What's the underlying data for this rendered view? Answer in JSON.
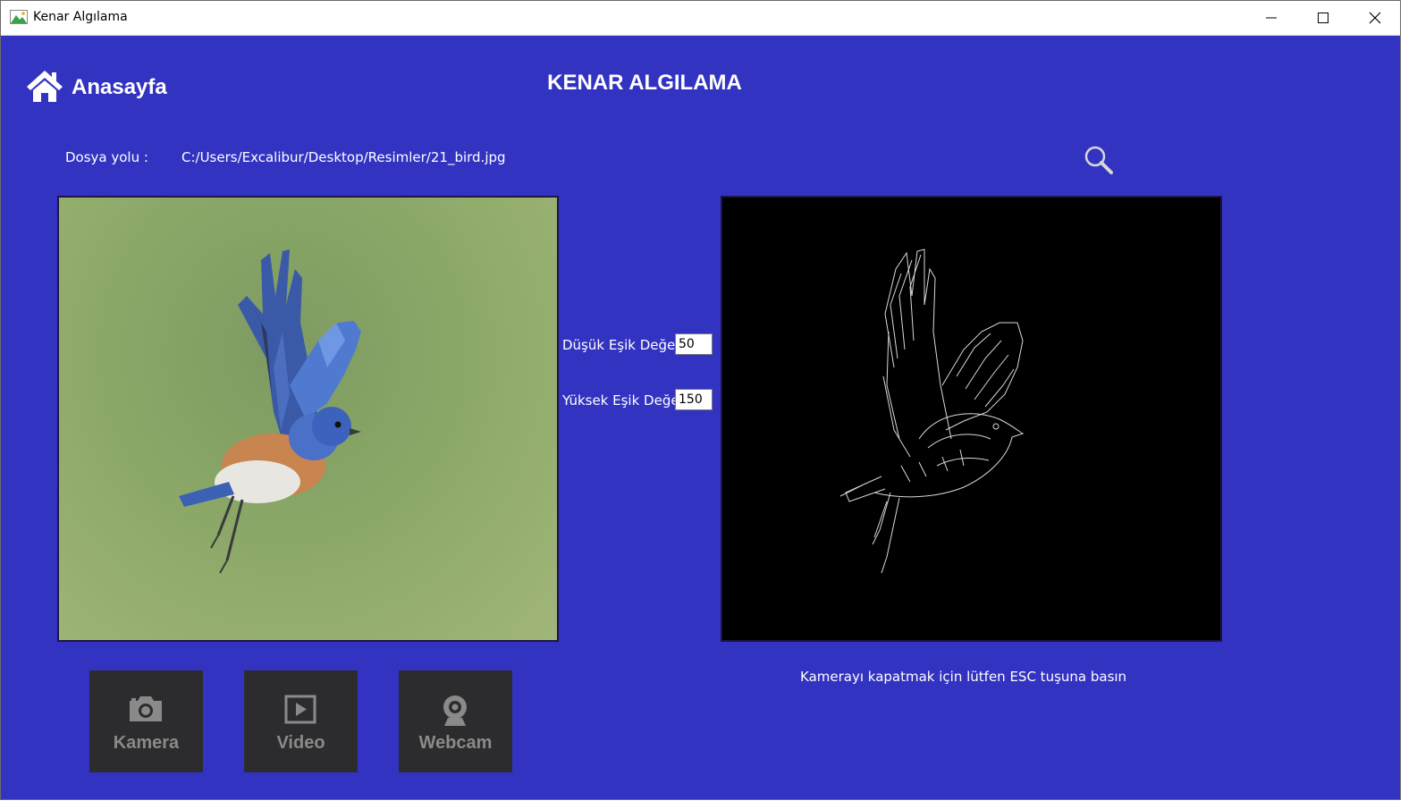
{
  "window": {
    "title": "Kenar Algılama"
  },
  "nav": {
    "home_label": "Anasayfa"
  },
  "main": {
    "title": "KENAR ALGILAMA",
    "path_label": "Dosya yolu :",
    "path_value": "C:/Users/Excalibur/Desktop/Resimler/21_bird.jpg"
  },
  "thresholds": {
    "low_label": "Düşük Eşik Değeri:",
    "low_value": "50",
    "high_label": "Yüksek Eşik Değeri:",
    "high_value": "150"
  },
  "note": "Kamerayı kapatmak için lütfen ESC tuşuna basın",
  "sources": [
    {
      "label": "Kamera",
      "icon": "camera-icon"
    },
    {
      "label": "Video",
      "icon": "video-icon"
    },
    {
      "label": "Webcam",
      "icon": "webcam-icon"
    }
  ],
  "colors": {
    "background": "#3333c2",
    "button_bg": "#2c2c2e",
    "button_text": "#8a8a8a"
  }
}
